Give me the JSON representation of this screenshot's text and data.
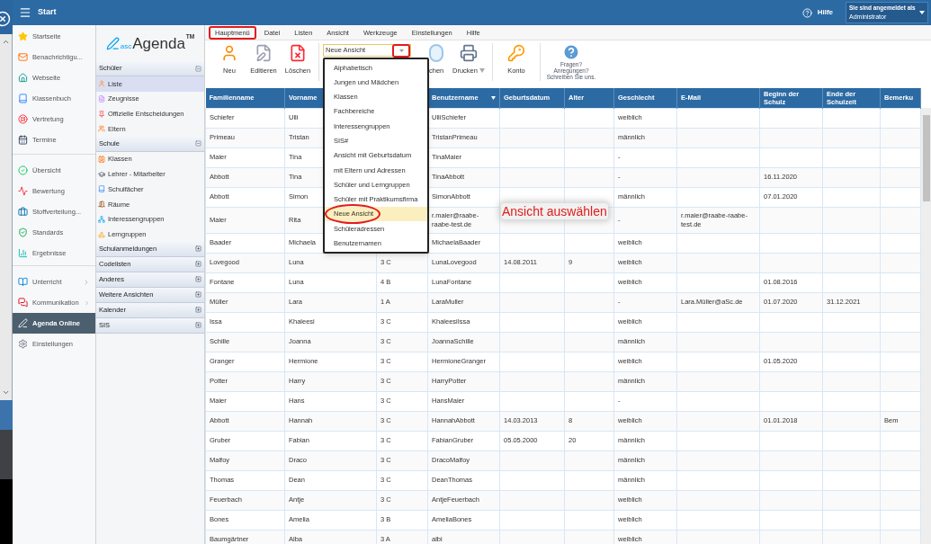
{
  "top_bar": {
    "title": "Start",
    "help": "Hilfe",
    "user_label": "Sie sind angemeldet als",
    "user_name": "Administrator"
  },
  "nav": {
    "groups": [
      {
        "items": [
          {
            "label": "Startseite",
            "selected": false,
            "submenu": false
          },
          {
            "label": "Benachrichtigu...",
            "selected": false,
            "submenu": false
          },
          {
            "label": "Webseite",
            "selected": false,
            "submenu": false
          },
          {
            "label": "Klassenbuch",
            "selected": false,
            "submenu": false
          },
          {
            "label": "Vertretung",
            "selected": false,
            "submenu": false
          },
          {
            "label": "Termine",
            "selected": false,
            "submenu": false
          }
        ]
      },
      {
        "items": [
          {
            "label": "Übersicht",
            "selected": false,
            "submenu": false
          },
          {
            "label": "Bewertung",
            "selected": false,
            "submenu": false
          },
          {
            "label": "Stoffverteilung...",
            "selected": false,
            "submenu": false
          },
          {
            "label": "Standards",
            "selected": false,
            "submenu": false
          },
          {
            "label": "Ergebnisse",
            "selected": false,
            "submenu": false
          }
        ]
      },
      {
        "items": [
          {
            "label": "Unterricht",
            "selected": false,
            "submenu": true
          },
          {
            "label": "Kommunikation",
            "selected": false,
            "submenu": true
          },
          {
            "label": "Agenda Online",
            "selected": true,
            "submenu": false
          },
          {
            "label": "Einstellungen",
            "selected": false,
            "submenu": false
          }
        ]
      }
    ]
  },
  "logo": {
    "prefix": "asc",
    "name": "Agenda",
    "mark": "TM"
  },
  "panel": {
    "sections": [
      {
        "title": "Schüler",
        "expanded": true,
        "items": [
          {
            "label": "Liste",
            "selected": true
          },
          {
            "label": "Zeugnisse",
            "selected": false
          },
          {
            "label": "Offizielle Entscheidungen",
            "selected": false
          },
          {
            "label": "Eltern",
            "selected": false
          }
        ]
      },
      {
        "title": "Schule",
        "expanded": true,
        "items": [
          {
            "label": "Klassen",
            "selected": false
          },
          {
            "label": "Lehrer - Mitarbeiter",
            "selected": false
          },
          {
            "label": "Schulfächer",
            "selected": false
          },
          {
            "label": "Räume",
            "selected": false
          },
          {
            "label": "Interessengruppen",
            "selected": false
          },
          {
            "label": "Lerngruppen",
            "selected": false
          }
        ]
      },
      {
        "title": "Schulanmeldungen",
        "expanded": false
      },
      {
        "title": "Codelisten",
        "expanded": false
      },
      {
        "title": "Anderes",
        "expanded": false
      },
      {
        "title": "Weitere Ansichten",
        "expanded": false
      },
      {
        "title": "Kalender",
        "expanded": false
      },
      {
        "title": "SIS",
        "expanded": false
      }
    ]
  },
  "menu_bar": [
    {
      "label": "Hauptmenü",
      "highlighted": true
    },
    {
      "label": "Datei",
      "highlighted": false
    },
    {
      "label": "Listen",
      "highlighted": false
    },
    {
      "label": "Ansicht",
      "highlighted": false
    },
    {
      "label": "Werkzeuge",
      "highlighted": false
    },
    {
      "label": "Einstellungen",
      "highlighted": false
    },
    {
      "label": "Hilfe",
      "highlighted": false
    }
  ],
  "toolbar": {
    "buttons_left": [
      {
        "label": "Neu"
      },
      {
        "label": "Editieren"
      },
      {
        "label": "Löschen"
      }
    ],
    "view_select": {
      "value": "Neue Ansicht",
      "arrow_highlighted": true,
      "open": true,
      "options": [
        {
          "label": "Alphabetisch",
          "selected": false,
          "circled": false
        },
        {
          "label": "Jungen und Mädchen",
          "selected": false,
          "circled": false
        },
        {
          "label": "Klassen",
          "selected": false,
          "circled": false
        },
        {
          "label": "Fachbereiche",
          "selected": false,
          "circled": false
        },
        {
          "label": "Interessengruppen",
          "selected": false,
          "circled": false
        },
        {
          "label": "SIS#",
          "selected": false,
          "circled": false
        },
        {
          "label": "Ansicht mit Geburtsdatum",
          "selected": false,
          "circled": false
        },
        {
          "label": "mit Eltern und Adressen",
          "selected": false,
          "circled": false
        },
        {
          "label": "Schüler und Lerngruppen",
          "selected": false,
          "circled": false
        },
        {
          "label": "Schüler mit Praktikumsfirma",
          "selected": false,
          "circled": false
        },
        {
          "label": "Neue Ansicht",
          "selected": true,
          "circled": true
        },
        {
          "label": "Schüleradressen",
          "selected": false,
          "circled": false
        },
        {
          "label": "Benutzernamen",
          "selected": false,
          "circled": false
        }
      ]
    },
    "buttons_right": [
      {
        "label": "chen",
        "has_menu": false
      },
      {
        "label": "Drucken",
        "has_menu": true
      },
      {
        "label": "Konto",
        "has_menu": false
      }
    ],
    "feedback": {
      "lines": [
        "Fragen?",
        "Anregungen?",
        "Schreiben Sie uns."
      ]
    }
  },
  "annotation": {
    "text": "Ansicht auswählen"
  },
  "table": {
    "columns": [
      {
        "label": "Familienname"
      },
      {
        "label": "Vorname"
      },
      {
        "label": "Benutzername",
        "sorted": true
      },
      {
        "label": "Geburtsdatum"
      },
      {
        "label": "Alter"
      },
      {
        "label": "Geschlecht"
      },
      {
        "label": "E-Mail"
      },
      {
        "label": "Beginn der Schulz"
      },
      {
        "label": "Ende der Schulzeit"
      },
      {
        "label": "Bemerku"
      }
    ],
    "rows": [
      {
        "familienname": "Schiefer",
        "vorname": "Ulli",
        "benutzername": "UlliSchiefer",
        "geschlecht": "weiblich"
      },
      {
        "familienname": "Primeau",
        "vorname": "Tristan",
        "benutzername": "TristanPrimeau",
        "geschlecht": "männlich"
      },
      {
        "familienname": "Maier",
        "vorname": "Tina",
        "benutzername": "TinaMaier",
        "geschlecht": "-"
      },
      {
        "familienname": "Abbott",
        "vorname": "Tina",
        "benutzername": "TinaAbbott",
        "geschlecht": "-",
        "beginn": "16.11.2020"
      },
      {
        "familienname": "Abbott",
        "vorname": "Simon",
        "benutzername": "SimonAbbott",
        "geschlecht": "männlich",
        "beginn": "07.01.2020"
      },
      {
        "familienname": "Maier",
        "vorname": "Rita",
        "benutzername": "r.maier@raabe-raabe-test.de",
        "geschlecht": "-",
        "email": "r.maier@raabe-raabe-test.de"
      },
      {
        "familienname": "Baader",
        "vorname": "Michaela",
        "benutzername": "MichaelaBaader",
        "geschlecht": "weiblich"
      },
      {
        "familienname": "Lovegood",
        "vorname": "Luna",
        "klasse": "3 C",
        "benutzername": "LunaLovegood",
        "geburtsdatum": "14.08.2011",
        "alter": "9",
        "geschlecht": "weiblich"
      },
      {
        "familienname": "Fontane",
        "vorname": "Luna",
        "klasse": "4 B",
        "benutzername": "LunaFontane",
        "geschlecht": "weiblich",
        "beginn": "01.08.2016"
      },
      {
        "familienname": "Müller",
        "vorname": "Lara",
        "klasse": "1 A",
        "benutzername": "LaraMuller",
        "geschlecht": "-",
        "email": "Lara.Müller@aSc.de",
        "beginn": "01.07.2020",
        "ende": "31.12.2021"
      },
      {
        "familienname": "Issa",
        "vorname": "Khaleesi",
        "klasse": "3 C",
        "benutzername": "KhaleesiIssa",
        "geschlecht": "weiblich"
      },
      {
        "familienname": "Schille",
        "vorname": "Joanna",
        "klasse": "3 C",
        "benutzername": "JoannaSchille",
        "geschlecht": "männlich"
      },
      {
        "familienname": "Granger",
        "vorname": "Hermione",
        "klasse": "3 C",
        "benutzername": "HermioneGranger",
        "geschlecht": "weiblich",
        "beginn": "01.05.2020"
      },
      {
        "familienname": "Potter",
        "vorname": "Harry",
        "klasse": "3 C",
        "benutzername": "HarryPotter",
        "geschlecht": "männlich"
      },
      {
        "familienname": "Maier",
        "vorname": "Hans",
        "klasse": "3 C",
        "benutzername": "HansMaier",
        "geschlecht": "-"
      },
      {
        "familienname": "Abbott",
        "vorname": "Hannah",
        "klasse": "3 C",
        "benutzername": "HannahAbbott",
        "geburtsdatum": "14.03.2013",
        "alter": "8",
        "geschlecht": "weiblich",
        "beginn": "01.01.2018",
        "bemerkung": "Bem"
      },
      {
        "familienname": "Gruber",
        "vorname": "Fabian",
        "klasse": "3 C",
        "benutzername": "FabianGruber",
        "geburtsdatum": "05.05.2000",
        "alter": "20",
        "geschlecht": "männlich"
      },
      {
        "familienname": "Malfoy",
        "vorname": "Draco",
        "klasse": "3 C",
        "benutzername": "DracoMalfoy",
        "geschlecht": "männlich"
      },
      {
        "familienname": "Thomas",
        "vorname": "Dean",
        "klasse": "3 C",
        "benutzername": "DeanThomas",
        "geschlecht": "männlich"
      },
      {
        "familienname": "Feuerbach",
        "vorname": "Antje",
        "klasse": "3 C",
        "benutzername": "AntjeFeuerbach",
        "geschlecht": "weiblich"
      },
      {
        "familienname": "Bones",
        "vorname": "Amelia",
        "klasse": "3 B",
        "benutzername": "AmeliaBones",
        "geschlecht": "weiblich"
      },
      {
        "familienname": "Baumgärtner",
        "vorname": "Alba",
        "klasse": "3 A",
        "benutzername": "albi",
        "geschlecht": "weiblich"
      }
    ]
  }
}
